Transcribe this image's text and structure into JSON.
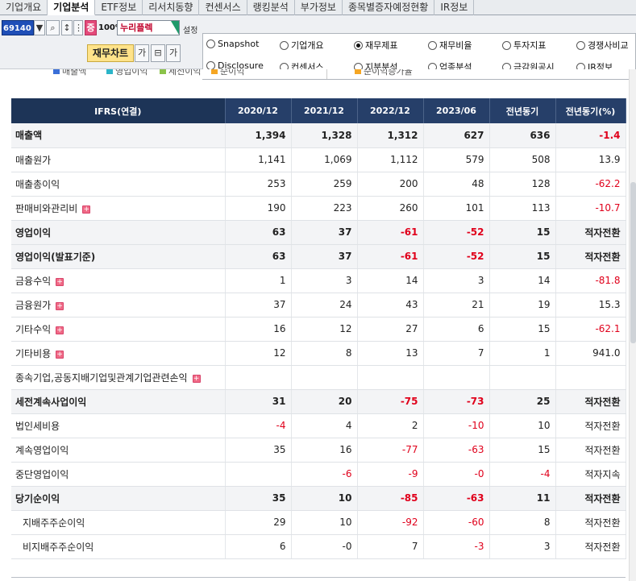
{
  "tabs": [
    {
      "label": "기업개요",
      "active": false
    },
    {
      "label": "기업분석",
      "active": true
    },
    {
      "label": "ETF정보",
      "active": false
    },
    {
      "label": "리서치동향",
      "active": false
    },
    {
      "label": "컨센서스",
      "active": false
    },
    {
      "label": "랭킹분석",
      "active": false
    },
    {
      "label": "부가정보",
      "active": false
    },
    {
      "label": "종목별증자예정현황",
      "active": false
    },
    {
      "label": "IR정보",
      "active": false
    }
  ],
  "toolbar": {
    "stock_code": "69140",
    "zoom": "100%",
    "stock_name": "누리플렉",
    "setting_label": "설정",
    "fin_chart_label": "재무차트",
    "small_btn_1": "가",
    "small_btn_2": "가",
    "jung_label": "증"
  },
  "radios": [
    {
      "label": "Snapshot",
      "checked": false
    },
    {
      "label": "기업개요",
      "checked": false
    },
    {
      "label": "재무제표",
      "checked": true
    },
    {
      "label": "재무비율",
      "checked": false
    },
    {
      "label": "투자지표",
      "checked": false
    },
    {
      "label": "경쟁사비교",
      "checked": false
    },
    {
      "label": "Disclosure",
      "checked": false
    },
    {
      "label": "컨센서스",
      "checked": false
    },
    {
      "label": "지분분석",
      "checked": false
    },
    {
      "label": "업종분석",
      "checked": false
    },
    {
      "label": "금감원공시",
      "checked": false
    },
    {
      "label": "IR정보",
      "checked": false
    }
  ],
  "legend": [
    {
      "label": "매출액",
      "color": "#3a6fd8"
    },
    {
      "label": "영업이익",
      "color": "#2bb5c9"
    },
    {
      "label": "세전이익",
      "color": "#8bc34a"
    },
    {
      "label": "순이익",
      "color": "#f5a623"
    },
    {
      "label": "순이익증가율",
      "color": "#f5a623"
    }
  ],
  "table": {
    "headers": [
      "IFRS(연결)",
      "2020/12",
      "2021/12",
      "2022/12",
      "2023/06",
      "전년동기",
      "전년동기(%)"
    ],
    "rows": [
      {
        "label": "매출액",
        "bold": true,
        "expand": false,
        "indent": false,
        "values": [
          "1,394",
          "1,328",
          "1,312",
          "627",
          "636",
          "-1.4"
        ]
      },
      {
        "label": "매출원가",
        "bold": false,
        "expand": false,
        "indent": false,
        "values": [
          "1,141",
          "1,069",
          "1,112",
          "579",
          "508",
          "13.9"
        ]
      },
      {
        "label": "매출총이익",
        "bold": false,
        "expand": false,
        "indent": false,
        "values": [
          "253",
          "259",
          "200",
          "48",
          "128",
          "-62.2"
        ]
      },
      {
        "label": "판매비와관리비",
        "bold": false,
        "expand": true,
        "indent": false,
        "values": [
          "190",
          "223",
          "260",
          "101",
          "113",
          "-10.7"
        ]
      },
      {
        "label": "영업이익",
        "bold": true,
        "expand": false,
        "indent": false,
        "values": [
          "63",
          "37",
          "-61",
          "-52",
          "15",
          "적자전환"
        ]
      },
      {
        "label": "영업이익(발표기준)",
        "bold": true,
        "expand": false,
        "indent": false,
        "values": [
          "63",
          "37",
          "-61",
          "-52",
          "15",
          "적자전환"
        ]
      },
      {
        "label": "금융수익",
        "bold": false,
        "expand": true,
        "indent": false,
        "values": [
          "1",
          "3",
          "14",
          "3",
          "14",
          "-81.8"
        ]
      },
      {
        "label": "금융원가",
        "bold": false,
        "expand": true,
        "indent": false,
        "values": [
          "37",
          "24",
          "43",
          "21",
          "19",
          "15.3"
        ]
      },
      {
        "label": "기타수익",
        "bold": false,
        "expand": true,
        "indent": false,
        "values": [
          "16",
          "12",
          "27",
          "6",
          "15",
          "-62.1"
        ]
      },
      {
        "label": "기타비용",
        "bold": false,
        "expand": true,
        "indent": false,
        "values": [
          "12",
          "8",
          "13",
          "7",
          "1",
          "941.0"
        ]
      },
      {
        "label": "종속기업,공동지배기업및관계기업관련손익",
        "bold": false,
        "expand": true,
        "indent": false,
        "values": [
          "",
          "",
          "",
          "",
          "",
          ""
        ]
      },
      {
        "label": "세전계속사업이익",
        "bold": true,
        "expand": false,
        "indent": false,
        "values": [
          "31",
          "20",
          "-75",
          "-73",
          "25",
          "적자전환"
        ]
      },
      {
        "label": "법인세비용",
        "bold": false,
        "expand": false,
        "indent": false,
        "values": [
          "-4",
          "4",
          "2",
          "-10",
          "10",
          "적자전환"
        ]
      },
      {
        "label": "계속영업이익",
        "bold": false,
        "expand": false,
        "indent": false,
        "values": [
          "35",
          "16",
          "-77",
          "-63",
          "15",
          "적자전환"
        ]
      },
      {
        "label": "중단영업이익",
        "bold": false,
        "expand": false,
        "indent": false,
        "values": [
          "",
          "-6",
          "-9",
          "-0",
          "-4",
          "적자지속"
        ]
      },
      {
        "label": "당기순이익",
        "bold": true,
        "expand": false,
        "indent": false,
        "values": [
          "35",
          "10",
          "-85",
          "-63",
          "11",
          "적자전환"
        ]
      },
      {
        "label": "지배주주순이익",
        "bold": false,
        "expand": false,
        "indent": true,
        "values": [
          "29",
          "10",
          "-92",
          "-60",
          "8",
          "적자전환"
        ]
      },
      {
        "label": "비지배주주순이익",
        "bold": false,
        "expand": false,
        "indent": true,
        "values": [
          "6",
          "-0",
          "7",
          "-3",
          "3",
          "적자전환"
        ]
      }
    ]
  }
}
